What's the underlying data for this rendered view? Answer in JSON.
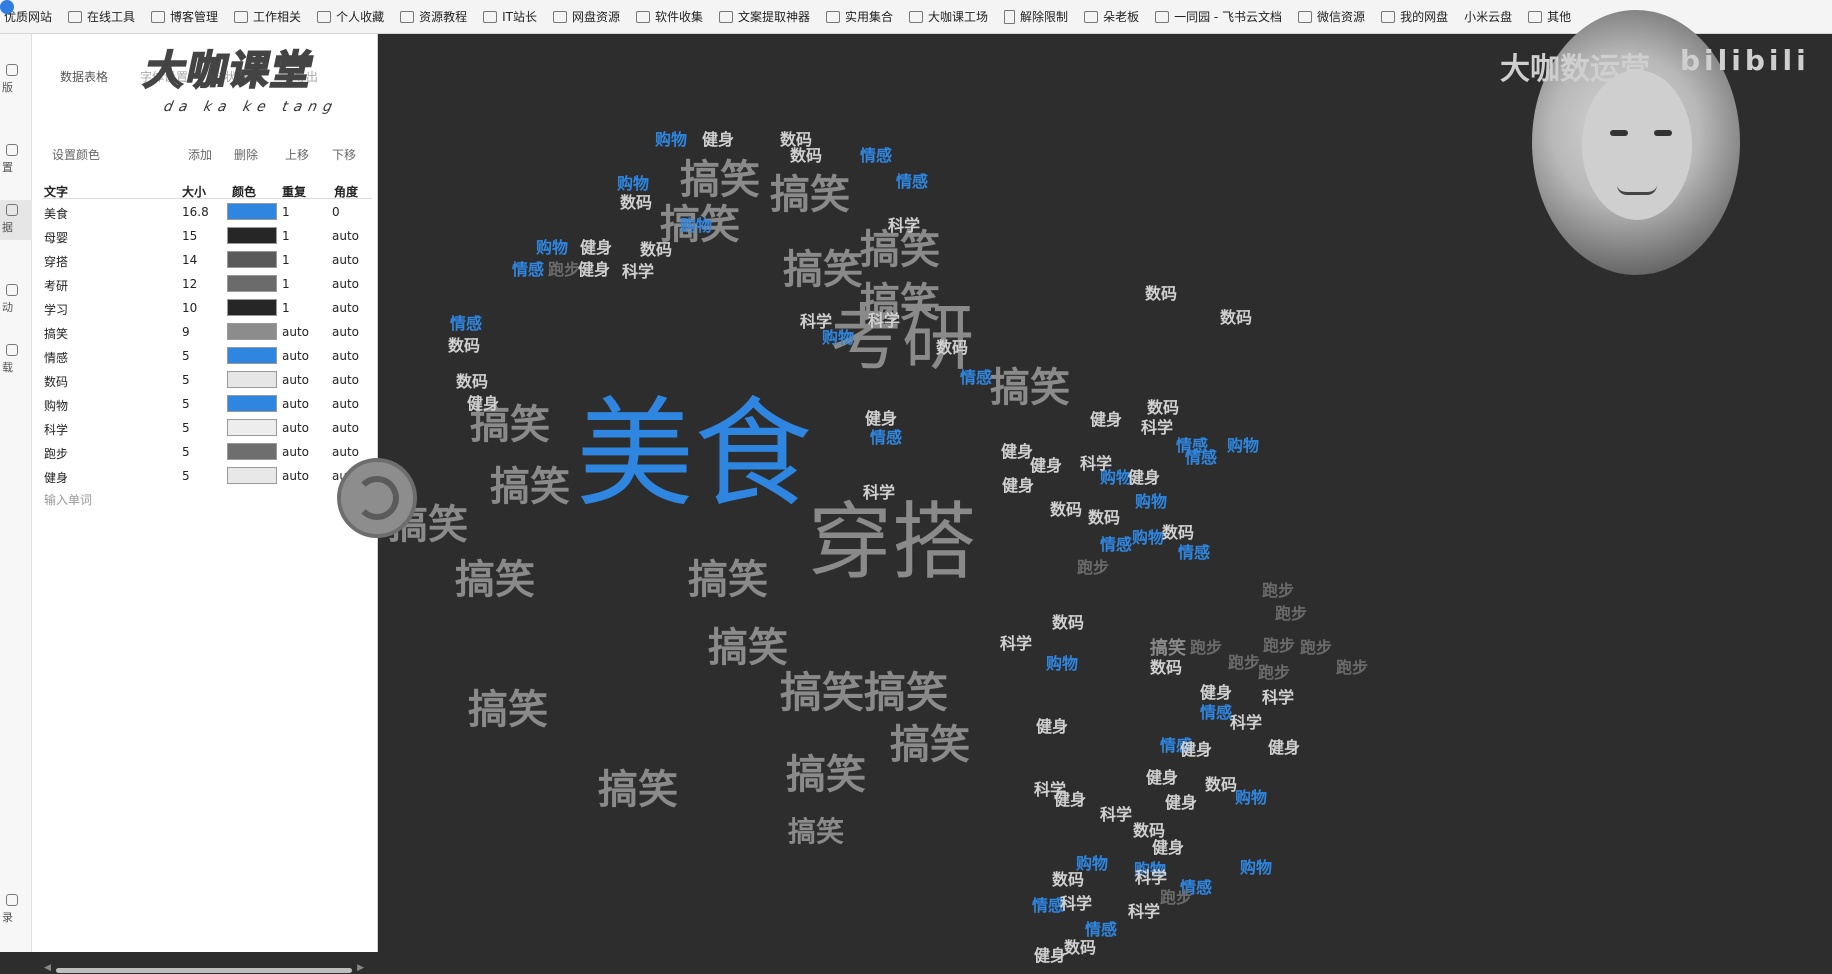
{
  "bookmarks": [
    {
      "label": "优质网站",
      "icon": "folder-icon"
    },
    {
      "label": "在线工具",
      "icon": "folder-icon"
    },
    {
      "label": "博客管理",
      "icon": "folder-icon"
    },
    {
      "label": "工作相关",
      "icon": "folder-icon"
    },
    {
      "label": "个人收藏",
      "icon": "folder-icon"
    },
    {
      "label": "资源教程",
      "icon": "folder-icon"
    },
    {
      "label": "IT站长",
      "icon": "folder-icon"
    },
    {
      "label": "网盘资源",
      "icon": "folder-icon"
    },
    {
      "label": "软件收集",
      "icon": "folder-icon"
    },
    {
      "label": "文案提取神器",
      "icon": "app-icon"
    },
    {
      "label": "实用集合",
      "icon": "folder-icon"
    },
    {
      "label": "大咖课工场",
      "icon": "folder-icon"
    },
    {
      "label": "解除限制",
      "icon": "document-icon"
    },
    {
      "label": "朵老板",
      "icon": "app-icon"
    },
    {
      "label": "一同园 - 飞书云文档",
      "icon": "app-icon"
    },
    {
      "label": "微信资源",
      "icon": "folder-icon"
    },
    {
      "label": "我的网盘",
      "icon": "folder-icon"
    },
    {
      "label": "小米云盘",
      "icon": "cloud-icon"
    },
    {
      "label": "其他",
      "icon": "folder-icon"
    }
  ],
  "sidebar": {
    "items": [
      {
        "label": "版",
        "icon": "template-icon"
      },
      {
        "label": "置",
        "icon": "settings-icon"
      },
      {
        "label": "据",
        "icon": "data-icon"
      },
      {
        "label": "动",
        "icon": "animation-icon"
      },
      {
        "label": "载",
        "icon": "download-icon"
      },
      {
        "label": "录",
        "icon": "record-icon"
      }
    ]
  },
  "panel": {
    "tabs": [
      "数据表格",
      "字体设置",
      "形状设置",
      "导出"
    ],
    "toolbar": {
      "set_color": "设置颜色",
      "add": "添加",
      "delete": "删除",
      "move_up": "上移",
      "move_down": "下移"
    },
    "columns": {
      "text": "文字",
      "size": "大小",
      "color": "颜色",
      "repeat": "重复",
      "angle": "角度"
    },
    "rows": [
      {
        "text": "美食",
        "size": "16.8",
        "color": "#2f86e0",
        "repeat": "1",
        "angle": "0"
      },
      {
        "text": "母婴",
        "size": "15",
        "color": "#262626",
        "repeat": "1",
        "angle": "auto"
      },
      {
        "text": "穿搭",
        "size": "14",
        "color": "#5a5a5a",
        "repeat": "1",
        "angle": "auto"
      },
      {
        "text": "考研",
        "size": "12",
        "color": "#6b6b6b",
        "repeat": "1",
        "angle": "auto"
      },
      {
        "text": "学习",
        "size": "10",
        "color": "#262626",
        "repeat": "1",
        "angle": "auto"
      },
      {
        "text": "搞笑",
        "size": "9",
        "color": "#8c8c8c",
        "repeat": "auto",
        "angle": "auto"
      },
      {
        "text": "情感",
        "size": "5",
        "color": "#2f86e0",
        "repeat": "auto",
        "angle": "auto"
      },
      {
        "text": "数码",
        "size": "5",
        "color": "#e6e6e6",
        "repeat": "auto",
        "angle": "auto"
      },
      {
        "text": "购物",
        "size": "5",
        "color": "#2f86e0",
        "repeat": "auto",
        "angle": "auto"
      },
      {
        "text": "科学",
        "size": "5",
        "color": "#ededed",
        "repeat": "auto",
        "angle": "auto"
      },
      {
        "text": "跑步",
        "size": "5",
        "color": "#6e6e6e",
        "repeat": "auto",
        "angle": "auto"
      },
      {
        "text": "健身",
        "size": "5",
        "color": "#e8e8e8",
        "repeat": "auto",
        "angle": "auto"
      }
    ],
    "add_word_placeholder": "输入单词"
  },
  "logo": {
    "main": "大咖课堂",
    "sub": "da ka ke tang"
  },
  "webcam": {
    "brand": "大咖数运营",
    "bilibili": "bilibili"
  },
  "cloud": {
    "colors": {
      "blue": "#2f86e0",
      "gray": "#8a8a8a",
      "light": "#d0d0d0",
      "dim": "#6a6a6a"
    },
    "words": [
      {
        "t": "美食",
        "c": "blue"
      },
      {
        "t": "考研",
        "c": "gray"
      },
      {
        "t": "穿搭",
        "c": "gray"
      },
      {
        "t": "搞笑",
        "c": "gray"
      },
      {
        "t": "搞笑",
        "c": "gray"
      },
      {
        "t": "搞笑",
        "c": "gray"
      },
      {
        "t": "搞笑",
        "c": "gray"
      },
      {
        "t": "搞笑",
        "c": "gray"
      },
      {
        "t": "搞笑",
        "c": "gray"
      },
      {
        "t": "搞笑",
        "c": "gray"
      },
      {
        "t": "搞笑",
        "c": "gray"
      },
      {
        "t": "搞笑",
        "c": "gray"
      },
      {
        "t": "搞笑",
        "c": "gray"
      },
      {
        "t": "搞笑",
        "c": "gray"
      },
      {
        "t": "搞笑",
        "c": "gray"
      },
      {
        "t": "搞笑",
        "c": "gray"
      },
      {
        "t": "搞笑",
        "c": "gray"
      },
      {
        "t": "搞笑",
        "c": "gray"
      },
      {
        "t": "搞笑",
        "c": "gray"
      },
      {
        "t": "搞笑",
        "c": "gray"
      },
      {
        "t": "搞笑",
        "c": "gray"
      },
      {
        "t": "搞笑搞笑",
        "c": "gray"
      },
      {
        "t": "搞笑",
        "c": "gray"
      },
      {
        "t": "购物",
        "c": "blue"
      },
      {
        "t": "健身",
        "c": "light"
      },
      {
        "t": "数码",
        "c": "light"
      },
      {
        "t": "数码",
        "c": "light"
      },
      {
        "t": "情感",
        "c": "blue"
      },
      {
        "t": "购物",
        "c": "blue"
      },
      {
        "t": "数码",
        "c": "light"
      },
      {
        "t": "情感",
        "c": "blue"
      },
      {
        "t": "科学",
        "c": "light"
      },
      {
        "t": "购物",
        "c": "blue"
      },
      {
        "t": "购物",
        "c": "blue"
      },
      {
        "t": "健身",
        "c": "light"
      },
      {
        "t": "数码",
        "c": "light"
      },
      {
        "t": "情感",
        "c": "blue"
      },
      {
        "t": "跑步",
        "c": "dim"
      },
      {
        "t": "科学",
        "c": "light"
      },
      {
        "t": "健身",
        "c": "light"
      },
      {
        "t": "科学",
        "c": "light"
      },
      {
        "t": "情感",
        "c": "blue"
      },
      {
        "t": "数码",
        "c": "light"
      },
      {
        "t": "数码",
        "c": "light"
      },
      {
        "t": "科学",
        "c": "light"
      },
      {
        "t": "购物",
        "c": "blue"
      },
      {
        "t": "情感",
        "c": "blue"
      },
      {
        "t": "数码",
        "c": "light"
      },
      {
        "t": "健身",
        "c": "light"
      },
      {
        "t": "数码",
        "c": "light"
      },
      {
        "t": "科学",
        "c": "light"
      },
      {
        "t": "数码",
        "c": "light"
      },
      {
        "t": "情感",
        "c": "blue"
      },
      {
        "t": "数码",
        "c": "light"
      },
      {
        "t": "健身",
        "c": "light"
      },
      {
        "t": "情感",
        "c": "blue"
      },
      {
        "t": "购物",
        "c": "blue"
      },
      {
        "t": "购物",
        "c": "blue"
      },
      {
        "t": "健身",
        "c": "light"
      },
      {
        "t": "情感",
        "c": "blue"
      },
      {
        "t": "科学",
        "c": "light"
      },
      {
        "t": "健身",
        "c": "light"
      },
      {
        "t": "科学",
        "c": "light"
      },
      {
        "t": "数码",
        "c": "light"
      },
      {
        "t": "健身",
        "c": "light"
      },
      {
        "t": "购物",
        "c": "blue"
      },
      {
        "t": "数码",
        "c": "light"
      },
      {
        "t": "情感",
        "c": "blue"
      },
      {
        "t": "健身",
        "c": "light"
      },
      {
        "t": "购物",
        "c": "blue"
      },
      {
        "t": "跑步",
        "c": "dim"
      },
      {
        "t": "健身",
        "c": "light"
      },
      {
        "t": "数码",
        "c": "light"
      },
      {
        "t": "情感",
        "c": "blue"
      },
      {
        "t": "数码",
        "c": "light"
      },
      {
        "t": "科学",
        "c": "light"
      },
      {
        "t": "购物",
        "c": "blue"
      },
      {
        "t": "健身",
        "c": "light"
      },
      {
        "t": "科学",
        "c": "light"
      },
      {
        "t": "健身",
        "c": "light"
      },
      {
        "t": "数码",
        "c": "light"
      },
      {
        "t": "科学",
        "c": "light"
      },
      {
        "t": "健身",
        "c": "light"
      },
      {
        "t": "数码",
        "c": "light"
      },
      {
        "t": "情感",
        "c": "blue"
      },
      {
        "t": "购物",
        "c": "blue"
      },
      {
        "t": "科学",
        "c": "light"
      },
      {
        "t": "健身",
        "c": "light"
      },
      {
        "t": "情感",
        "c": "blue"
      },
      {
        "t": "健身",
        "c": "light"
      },
      {
        "t": "数码",
        "c": "light"
      },
      {
        "t": "科学",
        "c": "light"
      },
      {
        "t": "购物",
        "c": "blue"
      },
      {
        "t": "情感",
        "c": "blue"
      },
      {
        "t": "购物",
        "c": "blue"
      },
      {
        "t": "跑步",
        "c": "dim"
      },
      {
        "t": "科学",
        "c": "light"
      },
      {
        "t": "健身",
        "c": "light"
      },
      {
        "t": "情感",
        "c": "blue"
      },
      {
        "t": "数码",
        "c": "light"
      },
      {
        "t": "购物",
        "c": "blue"
      },
      {
        "t": "健身",
        "c": "light"
      },
      {
        "t": "健身",
        "c": "light"
      },
      {
        "t": "科学",
        "c": "light"
      },
      {
        "t": "情感",
        "c": "blue"
      },
      {
        "t": "科学",
        "c": "light"
      },
      {
        "t": "健身",
        "c": "light"
      },
      {
        "t": "数码",
        "c": "light"
      },
      {
        "t": "跑步",
        "c": "dim"
      },
      {
        "t": "跑步",
        "c": "dim"
      },
      {
        "t": "跑步",
        "c": "dim"
      },
      {
        "t": "跑步",
        "c": "dim"
      },
      {
        "t": "跑步",
        "c": "dim"
      },
      {
        "t": "跑步",
        "c": "dim"
      },
      {
        "t": "跑步",
        "c": "dim"
      },
      {
        "t": "跑步",
        "c": "dim"
      }
    ]
  }
}
